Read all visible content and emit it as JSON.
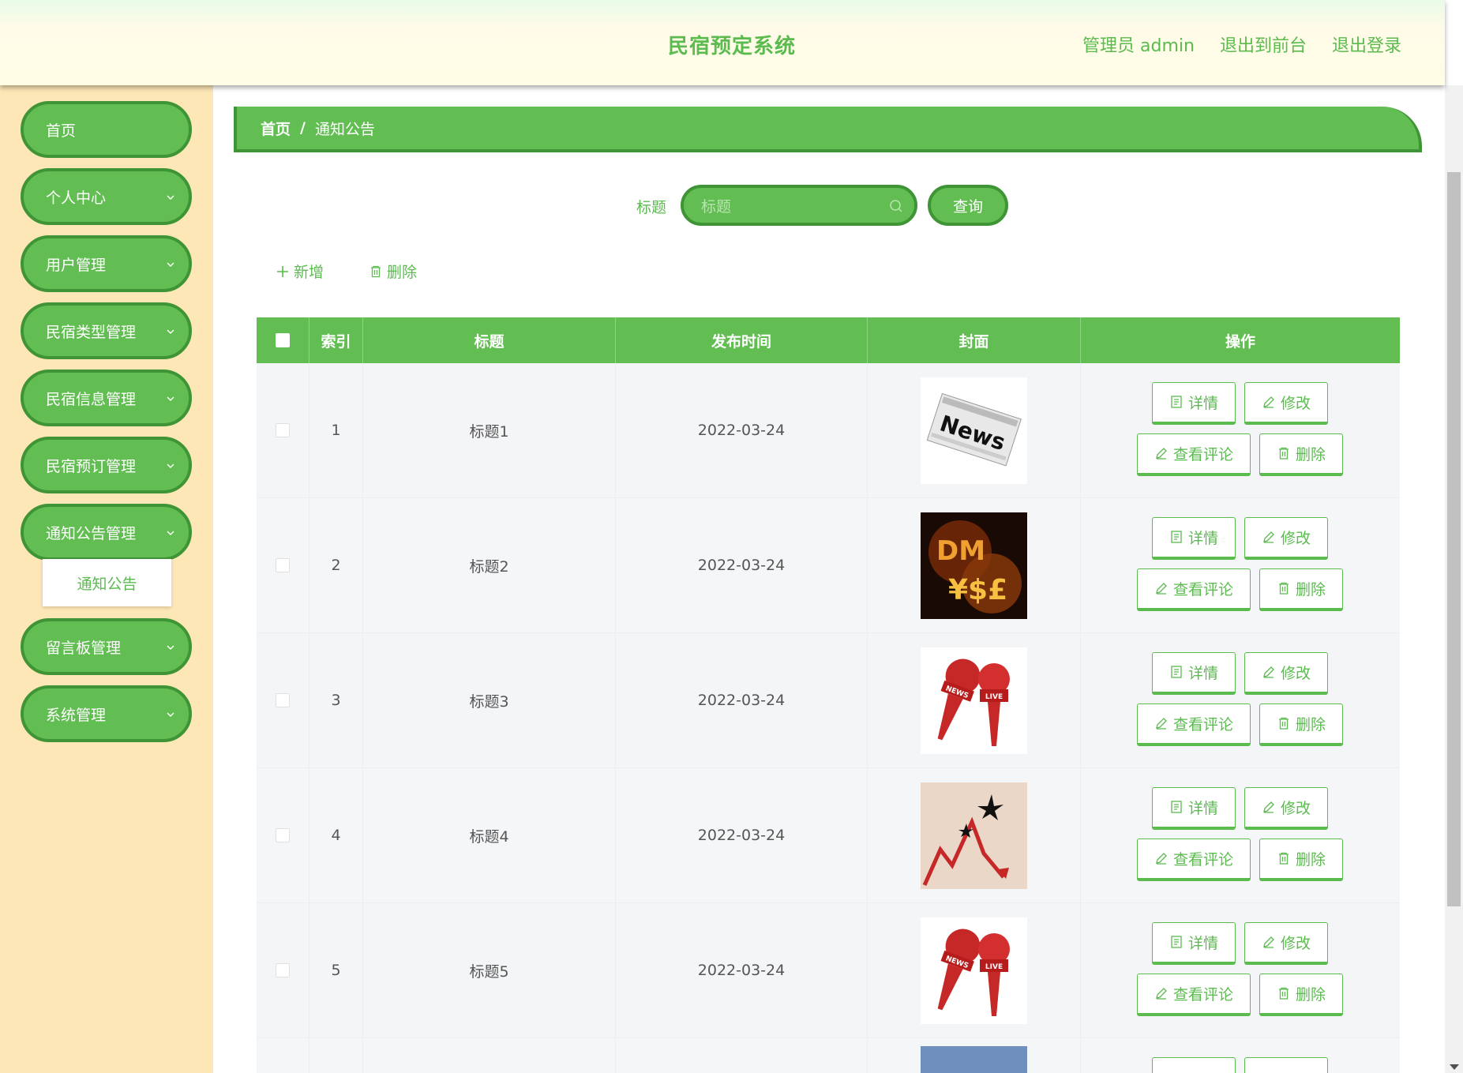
{
  "header": {
    "title": "民宿预定系统",
    "admin_label": "管理员 admin",
    "to_front": "退出到前台",
    "logout": "退出登录"
  },
  "sidebar": {
    "items": [
      {
        "label": "首页"
      },
      {
        "label": "个人中心"
      },
      {
        "label": "用户管理"
      },
      {
        "label": "民宿类型管理"
      },
      {
        "label": "民宿信息管理"
      },
      {
        "label": "民宿预订管理"
      },
      {
        "label": "通知公告管理"
      },
      {
        "label": "留言板管理"
      },
      {
        "label": "系统管理"
      }
    ],
    "submenu_item": "通知公告"
  },
  "breadcrumb": {
    "home": "首页",
    "separator": "/",
    "current": "通知公告"
  },
  "search": {
    "label": "标题",
    "placeholder": "标题",
    "button": "查询"
  },
  "toolbar": {
    "add": "新增",
    "delete": "删除"
  },
  "table": {
    "headers": [
      "索引",
      "标题",
      "发布时间",
      "封面",
      "操作"
    ],
    "rows": [
      {
        "index": "1",
        "title": "标题1",
        "date": "2022-03-24",
        "cover": "newspaper-image"
      },
      {
        "index": "2",
        "title": "标题2",
        "date": "2022-03-24",
        "cover": "currency-symbols-image"
      },
      {
        "index": "3",
        "title": "标题3",
        "date": "2022-03-24",
        "cover": "news-microphones-image"
      },
      {
        "index": "4",
        "title": "标题4",
        "date": "2022-03-24",
        "cover": "chart-arrow-image"
      },
      {
        "index": "5",
        "title": "标题5",
        "date": "2022-03-24",
        "cover": "news-microphones-image"
      }
    ],
    "actions": {
      "detail": "详情",
      "edit": "修改",
      "comments": "查看评论",
      "delete": "删除"
    }
  },
  "colors": {
    "accent": "#62be52",
    "accent_dark": "#3f9536",
    "sidebar_bg": "#fde7b6"
  }
}
